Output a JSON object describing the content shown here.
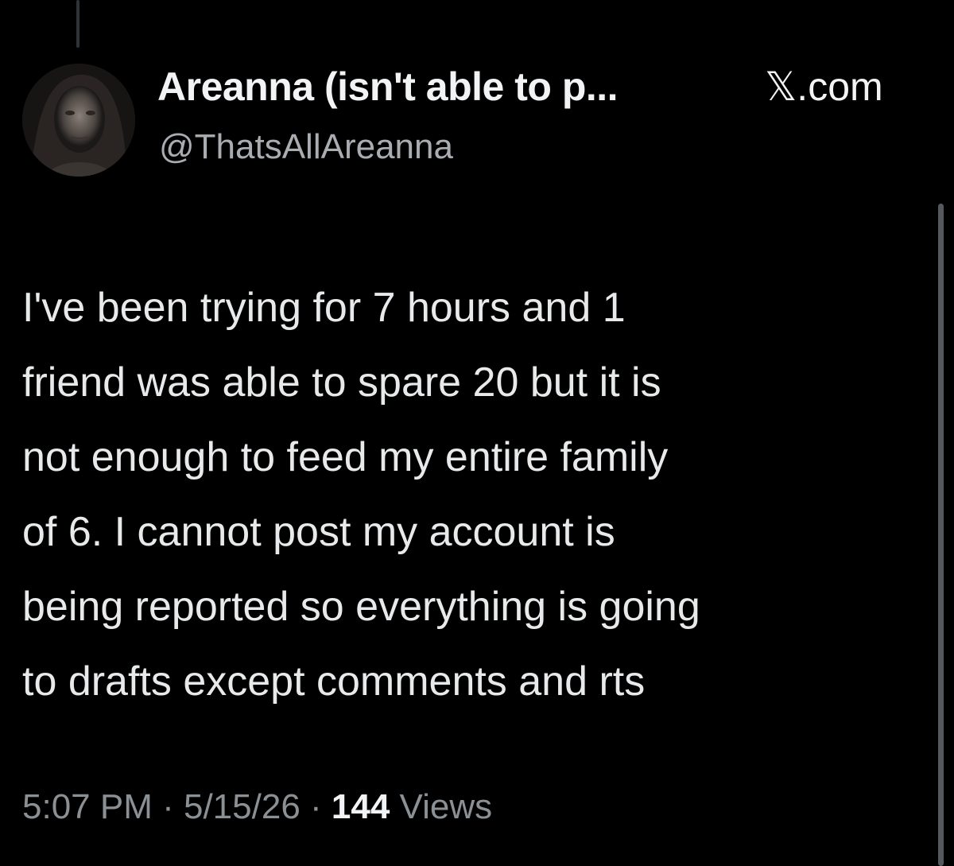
{
  "author": {
    "display_name": "Areanna (isn't able to p...",
    "handle": "@ThatsAllAreanna",
    "avatar_icon": "profile-photo"
  },
  "source": {
    "x_symbol": "𝕏",
    "domain": ".com"
  },
  "tweet": {
    "lines": [
      "I've been trying for 7 hours and 1",
      "friend was able to spare 20 but it is",
      "not enough to feed my entire family",
      "of 6. I cannot post my account is",
      "being reported so everything is going",
      "to drafts except comments and rts"
    ]
  },
  "meta": {
    "time": "5:07 PM",
    "separator": " · ",
    "date": "5/15/26",
    "views_count": "144",
    "views_label": " Views"
  },
  "colors": {
    "background": "#000000",
    "primary_text": "#e7e9ea",
    "secondary_text": "#8b9095"
  }
}
